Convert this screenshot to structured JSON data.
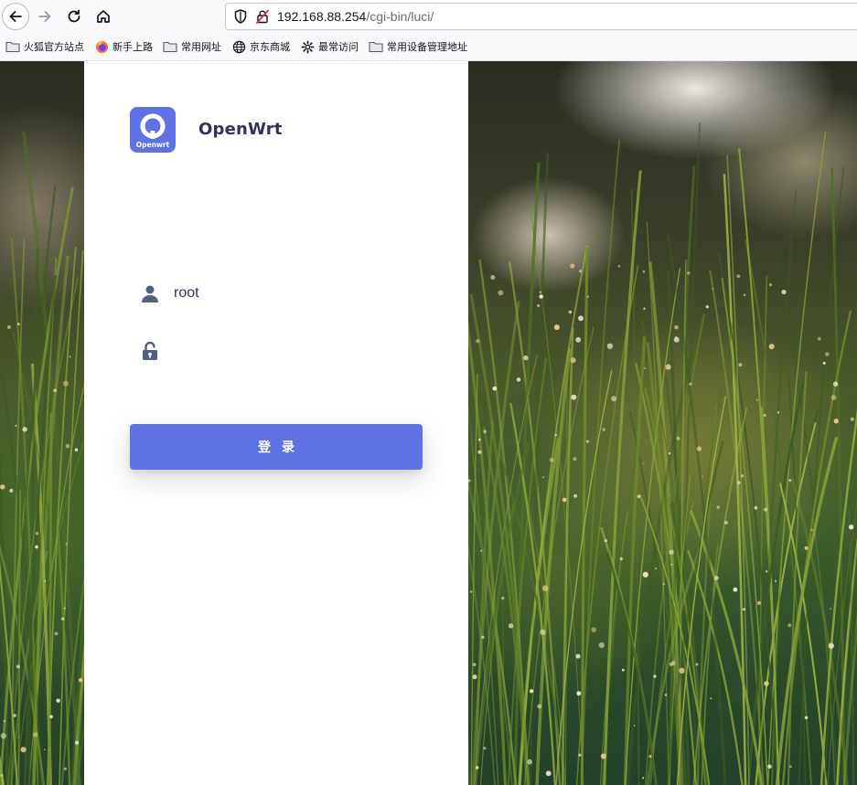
{
  "browser": {
    "url_host": "192.168.88.254",
    "url_path": "/cgi-bin/luci/",
    "icons": {
      "back": "arrow-left-icon",
      "forward": "arrow-right-icon",
      "reload": "reload-icon",
      "home": "home-icon",
      "shield": "shield-icon",
      "lock": "insecure-lock-icon"
    }
  },
  "bookmarks": [
    {
      "label": "火狐官方站点",
      "icon": "folder-icon"
    },
    {
      "label": "新手上路",
      "icon": "firefox-icon"
    },
    {
      "label": "常用网址",
      "icon": "folder-icon"
    },
    {
      "label": "京东商城",
      "icon": "globe-icon"
    },
    {
      "label": "最常访问",
      "icon": "gear-icon"
    },
    {
      "label": "常用设备管理地址",
      "icon": "folder-icon"
    }
  ],
  "login": {
    "logo_caption": "Openwrt",
    "title": "OpenWrt",
    "username_value": "root",
    "password_value": "",
    "submit_label": "登录"
  },
  "colors": {
    "accent": "#5e72e4",
    "text": "#32325d"
  }
}
